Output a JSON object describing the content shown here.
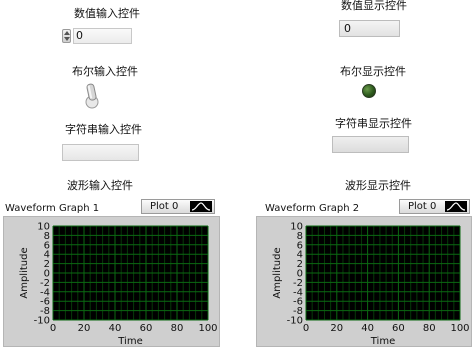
{
  "numeric_control": {
    "label": "数值输入控件",
    "value": "0"
  },
  "numeric_indicator": {
    "label": "数值显示控件",
    "value": "0"
  },
  "boolean_control": {
    "label": "布尔输入控件"
  },
  "boolean_indicator": {
    "label": "布尔显示控件"
  },
  "string_control": {
    "label": "字符串输入控件",
    "value": ""
  },
  "string_indicator": {
    "label": "字符串显示控件",
    "value": ""
  },
  "waveform_control": {
    "label": "波形输入控件"
  },
  "waveform_indicator": {
    "label": "波形显示控件"
  },
  "colors": {
    "plot_bg": "#000000",
    "grid": "#0b6a12",
    "led_off": "#2d5a1d"
  },
  "chart_data": [
    {
      "type": "line",
      "title": "Waveform Graph 1",
      "legend": [
        "Plot 0"
      ],
      "xlabel": "Time",
      "ylabel": "Amplitude",
      "xlim": [
        0,
        100
      ],
      "ylim": [
        -10,
        10
      ],
      "x_ticks": [
        "0",
        "20",
        "40",
        "60",
        "80",
        "100"
      ],
      "y_ticks": [
        "10",
        "8",
        "6",
        "4",
        "2",
        "0",
        "-2",
        "-4",
        "-6",
        "-8",
        "-10"
      ],
      "grid": true,
      "series": []
    },
    {
      "type": "line",
      "title": "Waveform Graph 2",
      "legend": [
        "Plot 0"
      ],
      "xlabel": "Time",
      "ylabel": "Amplitude",
      "xlim": [
        0,
        100
      ],
      "ylim": [
        -10,
        10
      ],
      "x_ticks": [
        "0",
        "20",
        "40",
        "60",
        "80",
        "100"
      ],
      "y_ticks": [
        "10",
        "8",
        "6",
        "4",
        "2",
        "0",
        "-2",
        "-4",
        "-6",
        "-8",
        "-10"
      ],
      "grid": true,
      "series": []
    }
  ]
}
